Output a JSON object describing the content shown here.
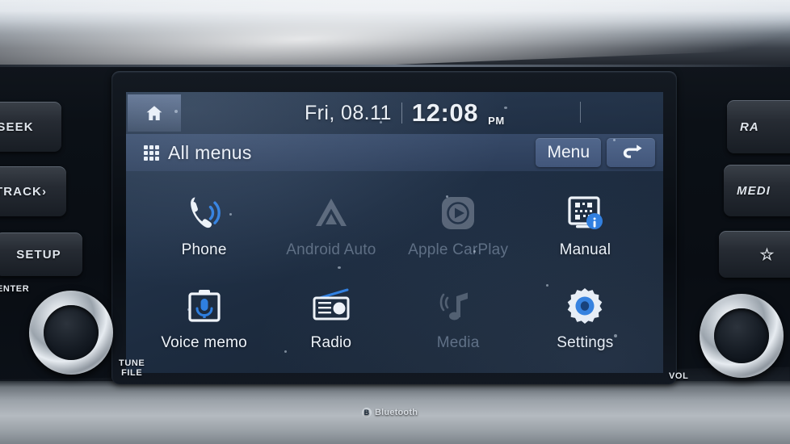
{
  "device": {
    "type": "car-infotainment-head-unit",
    "bottom_badge": "Bluetooth",
    "bt_mark": "B"
  },
  "screen": {
    "statusbar": {
      "home_icon": "home-icon",
      "date": "Fri, 08.11",
      "time": "12:08",
      "ampm": "PM"
    },
    "titlebar": {
      "grid_icon": "grid-icon",
      "title": "All menus",
      "menu_label": "Menu",
      "back_label": "↩"
    },
    "apps": [
      {
        "label": "Phone",
        "icon": "phone-icon",
        "enabled": true
      },
      {
        "label": "Android Auto",
        "icon": "android-auto-icon",
        "enabled": false
      },
      {
        "label": "Apple CarPlay",
        "icon": "apple-carplay-icon",
        "enabled": false
      },
      {
        "label": "Manual",
        "icon": "manual-qr-icon",
        "enabled": true
      },
      {
        "label": "Voice memo",
        "icon": "voice-memo-icon",
        "enabled": true
      },
      {
        "label": "Radio",
        "icon": "radio-icon",
        "enabled": true
      },
      {
        "label": "Media",
        "icon": "media-note-icon",
        "enabled": false
      },
      {
        "label": "Settings",
        "icon": "settings-gear-icon",
        "enabled": true
      }
    ]
  },
  "hardware": {
    "left_buttons": [
      {
        "id": "seek",
        "label": "SEEK"
      },
      {
        "id": "track",
        "label": "TRACK›"
      },
      {
        "id": "setup",
        "label": "SETUP"
      }
    ],
    "right_buttons": [
      {
        "id": "radio",
        "label": "RA"
      },
      {
        "id": "media",
        "label": "MEDI"
      },
      {
        "id": "star",
        "label": "☆"
      }
    ],
    "labels": {
      "enter": "ENTER",
      "tune_file": "TUNE\nFILE",
      "tune_line1": "TUNE",
      "tune_line2": "FILE",
      "vol": "VOL"
    },
    "knobs": [
      {
        "id": "tune-knob",
        "label": "TUNE FILE"
      },
      {
        "id": "vol-knob",
        "label": "VOL"
      }
    ]
  },
  "colors": {
    "screen_bg": "#1d2c40",
    "accent_blue": "#2f7fe0",
    "titlebar_blue": "#3f5375",
    "button_blue": "#51678c",
    "text_light": "#eef3f9",
    "text_disabled": "#5d6d82",
    "bezel_black": "#0b1016",
    "console_silver": "#b4bac0"
  }
}
